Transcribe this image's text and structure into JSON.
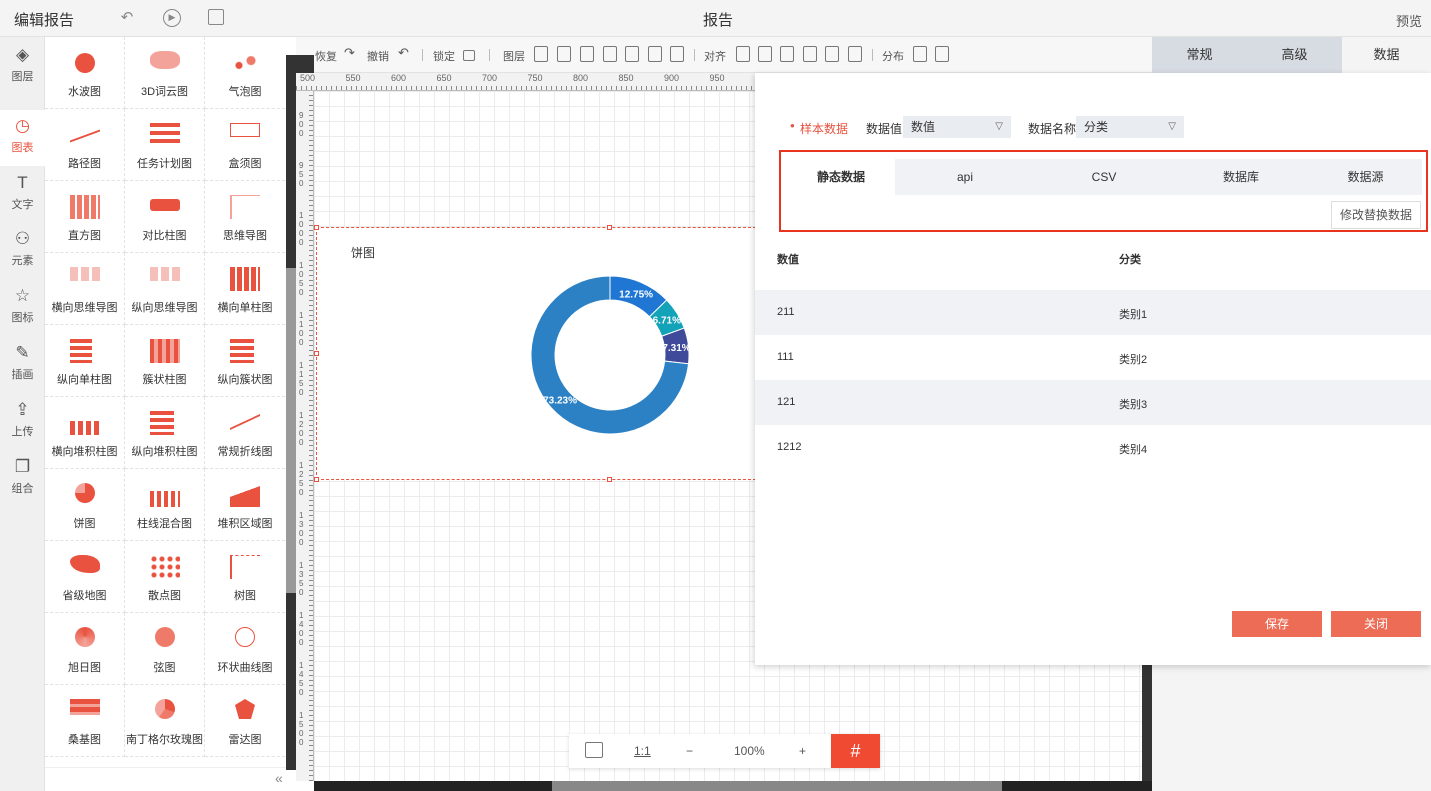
{
  "header": {
    "title": "编辑报告",
    "center_title": "报告",
    "preview": "预览"
  },
  "left_nav": [
    {
      "label": "图层",
      "icon": "layers-icon",
      "glyph": "◈"
    },
    {
      "label": "图表",
      "icon": "chart-icon",
      "glyph": "◷"
    },
    {
      "label": "文字",
      "icon": "text-icon",
      "glyph": "T"
    },
    {
      "label": "元素",
      "icon": "elements-icon",
      "glyph": "⚇"
    },
    {
      "label": "图标",
      "icon": "star-icon",
      "glyph": "☆"
    },
    {
      "label": "插画",
      "icon": "palette-icon",
      "glyph": "✎"
    },
    {
      "label": "上传",
      "icon": "upload-icon",
      "glyph": "⇪"
    },
    {
      "label": "组合",
      "icon": "group-icon",
      "glyph": "❐"
    }
  ],
  "chart_library": [
    "水波图",
    "3D词云图",
    "气泡图",
    "路径图",
    "任务计划图",
    "盒须图",
    "直方图",
    "对比柱图",
    "思维导图",
    "横向思维导图",
    "纵向思维导图",
    "横向单柱图",
    "纵向单柱图",
    "簇状柱图",
    "纵向簇状图",
    "横向堆积柱图",
    "纵向堆积柱图",
    "常规折线图",
    "饼图",
    "柱线混合图",
    "堆积区域图",
    "省级地图",
    "散点图",
    "树图",
    "旭日图",
    "弦图",
    "环状曲线图",
    "桑基图",
    "南丁格尔玫瑰图",
    "雷达图"
  ],
  "toolbar": {
    "undo": "恢复",
    "redo": "撤销",
    "lock": "锁定",
    "layer": "图层",
    "align": "对齐",
    "distribute": "分布"
  },
  "ruler_top": [
    "500",
    "550",
    "600",
    "650",
    "700",
    "750",
    "800",
    "850",
    "900",
    "950"
  ],
  "ruler_left": [
    "900",
    "950",
    "1000",
    "1050",
    "1100",
    "1150",
    "1200",
    "1250",
    "1300",
    "1350",
    "1400",
    "1450",
    "1500"
  ],
  "chart": {
    "title": "饼图"
  },
  "chart_data": {
    "type": "pie",
    "title": "饼图",
    "categories": [
      "类别1",
      "类别2",
      "类别3",
      "类别4"
    ],
    "values": [
      211,
      111,
      121,
      1212
    ],
    "labels": [
      "12.75%",
      "6.71%",
      "7.31%",
      "73.23%"
    ],
    "colors": [
      "#1f77d3",
      "#13a3b8",
      "#3f4a9a",
      "#2b81c4"
    ]
  },
  "zoom": {
    "ratio": "1:1",
    "minus": "−",
    "level": "100%",
    "plus": "+",
    "grid_glyph": "#"
  },
  "right_tabs": [
    "常规",
    "高级",
    "数据"
  ],
  "data_panel": {
    "sample_label": "样本数据",
    "value_label": "数据值",
    "value_select": "数值",
    "name_label": "数据名称",
    "name_select": "分类",
    "source_tabs": [
      "静态数据",
      "api",
      "CSV",
      "数据库",
      "数据源"
    ],
    "modify_button": "修改替换数据",
    "col_value": "数值",
    "col_category": "分类",
    "rows": [
      {
        "value": "211",
        "category": "类别1"
      },
      {
        "value": "111",
        "category": "类别2"
      },
      {
        "value": "121",
        "category": "类别3"
      },
      {
        "value": "1212",
        "category": "类别4"
      }
    ],
    "save": "保存",
    "close": "关闭"
  }
}
